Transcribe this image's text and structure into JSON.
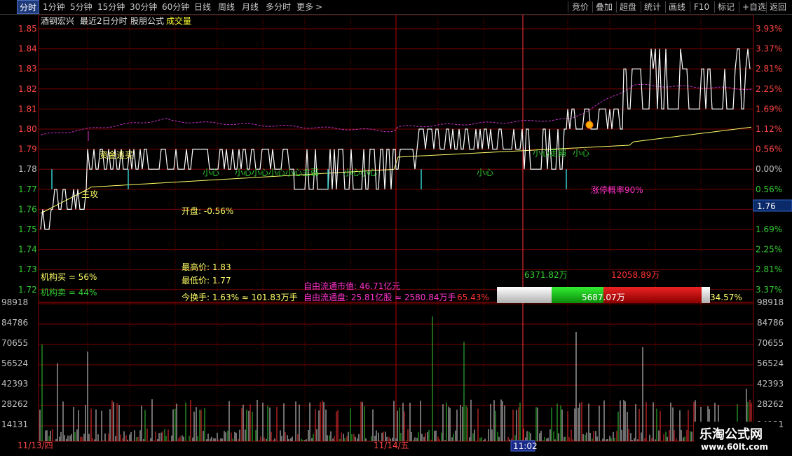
{
  "toolbar": {
    "left": [
      "分时",
      "1分钟",
      "5分钟",
      "15分钟",
      "30分钟",
      "60分钟",
      "日线",
      "周线",
      "月线",
      "多分时",
      "更多"
    ],
    "more_arrow": ">",
    "right": [
      "竞价",
      "叠加",
      "超盘",
      "统计",
      "画线",
      "F10",
      "标记",
      "+自选",
      "返回"
    ]
  },
  "header": {
    "stock_name": "酒钢宏兴",
    "period_label": "最近2日分时",
    "formula_label": "股朋公式",
    "volume_label": "成交量"
  },
  "price_axis": [
    "1.85",
    "1.84",
    "1.83",
    "1.82",
    "1.81",
    "1.80",
    "1.79",
    "1.78",
    "1.77",
    "1.76",
    "1.75",
    "1.74",
    "1.73",
    "1.72"
  ],
  "pct_axis_upper": [
    "3.93%",
    "3.37%",
    "2.81%",
    "2.25%",
    "1.69%",
    "1.12%",
    "0.56%",
    "0.00%",
    "0.56%"
  ],
  "current_price": "1.76",
  "pct_axis_lower": [
    "1.69%",
    "2.25%",
    "2.81%",
    "3.37%"
  ],
  "volume_axis": [
    "98918",
    "84786",
    "70655",
    "56524",
    "42393",
    "28262",
    "14131"
  ],
  "date_labels": [
    "11/13/四",
    "11/14/五"
  ],
  "time_cursor": "11:02",
  "signals": {
    "capital_chase": "资金追买",
    "main_attack": "主攻",
    "caution_1": "小心",
    "caution_2": "小心小心小心小心主弱",
    "caution_3": "小心小心",
    "caution_4": "小心",
    "caution_5": "小心走弱",
    "caution_6": "小心",
    "limit_up_prob": "涨停概率90%"
  },
  "stats": {
    "open": "开盘: -0.56%",
    "high": "最高价: 1.83",
    "low": "最低价: 1.77",
    "turnover": "今换手: 1.63% ≈ 101.83万手",
    "inst_buy": "机构买 = 56%",
    "inst_sell": "机构卖 = 44%",
    "float_mktcap": "自由流通市值: 46.71亿元",
    "float_shares": "自由流通盘: 25.81亿股 ≈ 2580.84万手",
    "float_pct": "65.43%"
  },
  "bar_gauge": {
    "green_top": "6371.82万",
    "red_top": "12058.89万",
    "center": "5687.07万",
    "right_pct": "34.57%"
  },
  "watermark": {
    "title": "乐淘公式网",
    "url": "www.60lt.com"
  },
  "colors": {
    "price_line": "#ffffff",
    "avg_line": "#ffff66",
    "magenta_line": "#cc33cc",
    "grid": "#8b0000",
    "axis_red": "#ff4444",
    "axis_green": "#33cc33",
    "cyan": "#33cccc"
  }
}
